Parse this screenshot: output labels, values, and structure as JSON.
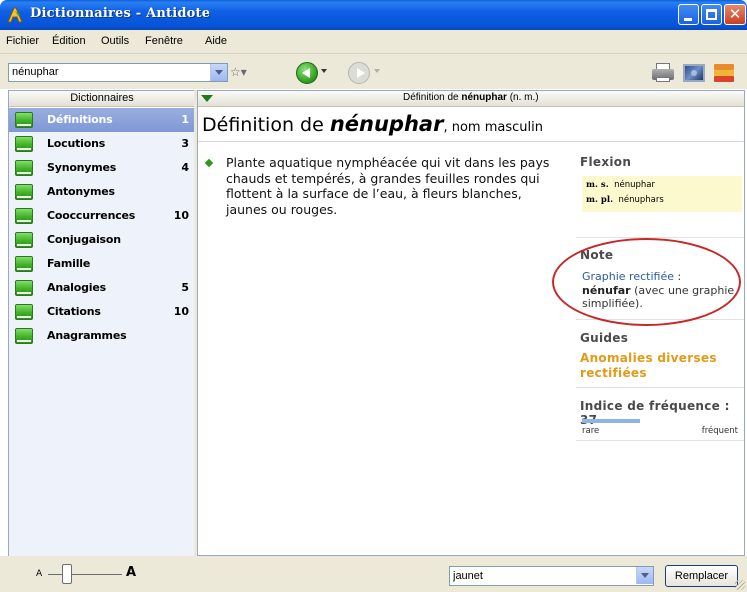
{
  "window": {
    "title": "Dictionnaires - Antidote"
  },
  "menu": {
    "items": [
      "Fichier",
      "Édition",
      "Outils",
      "Fenêtre",
      "Aide"
    ]
  },
  "toolbar": {
    "search_value": "nénuphar",
    "favorites_glyph": "☆▾",
    "icons": [
      "star-icon",
      "back-arrow-icon",
      "forward-arrow-icon",
      "print-icon",
      "image-icon",
      "books-icon"
    ]
  },
  "sidebar": {
    "header": "Dictionnaires",
    "items": [
      {
        "label": "Définitions",
        "count": "1",
        "selected": true
      },
      {
        "label": "Locutions",
        "count": "3"
      },
      {
        "label": "Synonymes",
        "count": "4"
      },
      {
        "label": "Antonymes",
        "count": ""
      },
      {
        "label": "Cooccurrences",
        "count": "10"
      },
      {
        "label": "Conjugaison",
        "count": ""
      },
      {
        "label": "Famille",
        "count": ""
      },
      {
        "label": "Analogies",
        "count": "5"
      },
      {
        "label": "Citations",
        "count": "10"
      },
      {
        "label": "Anagrammes",
        "count": ""
      }
    ]
  },
  "main": {
    "header": {
      "prefix": "Définition de ",
      "word": "nénuphar",
      "suffix": " (n. m.)"
    },
    "title": {
      "prefix": "Définition de ",
      "word": "nénuphar",
      "suffix": ", nom masculin"
    },
    "definition": "Plante aquatique nymphéacée qui vit dans les pays chauds et tempérés, à grandes feuilles rondes qui flottent à la surface de l’eau, à fleurs blanches, jaunes ou rouges.",
    "flexion": {
      "title": "Flexion",
      "rows": [
        {
          "tag": "m. s.",
          "form": "nénuphar"
        },
        {
          "tag": "m. pl.",
          "form": "nénuphars"
        }
      ]
    },
    "note": {
      "title": "Note",
      "link": "Graphie rectifiée",
      "colon": " :",
      "word": "nénufar",
      "rest": " (avec une graphie simplifiée)."
    },
    "guides": {
      "title": "Guides",
      "link": "Anomalies diverses rectifiées"
    },
    "frequency": {
      "title": "Indice de fréquence : 37",
      "value": 37,
      "scale_max": 100,
      "label_low": "rare",
      "label_high": "fréquent"
    }
  },
  "status": {
    "zoom_small": "A",
    "zoom_large": "A",
    "zoom_level": 0.25,
    "replace_value": "jaunet",
    "replace_button": "Remplacer"
  },
  "colors": {
    "accent_green": "#2a9a1a",
    "selection": "#8aa1d9",
    "guide_orange": "#e39a16",
    "note_blue": "#2c5aa0",
    "annotation_red": "#c72828"
  }
}
